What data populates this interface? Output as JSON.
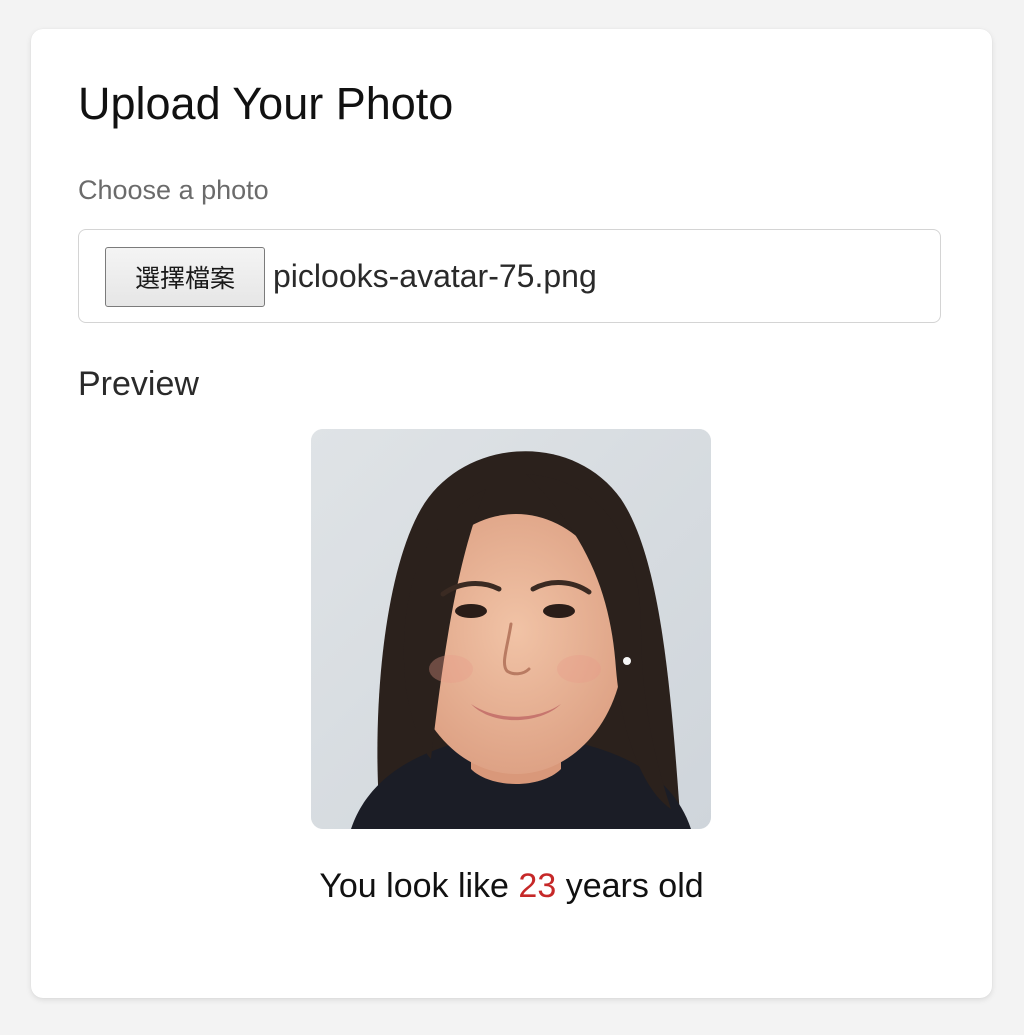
{
  "page": {
    "title": "Upload Your Photo"
  },
  "upload": {
    "label": "Choose a photo",
    "button_label": "選擇檔案",
    "file_name": "piclooks-avatar-75.png"
  },
  "preview": {
    "heading": "Preview",
    "image_description": "headshot-photo"
  },
  "result": {
    "prefix": "You look like",
    "age": "23",
    "suffix": "years old"
  },
  "colors": {
    "accent_age": "#c62828",
    "card_background": "#ffffff",
    "page_background": "#f3f3f3"
  }
}
